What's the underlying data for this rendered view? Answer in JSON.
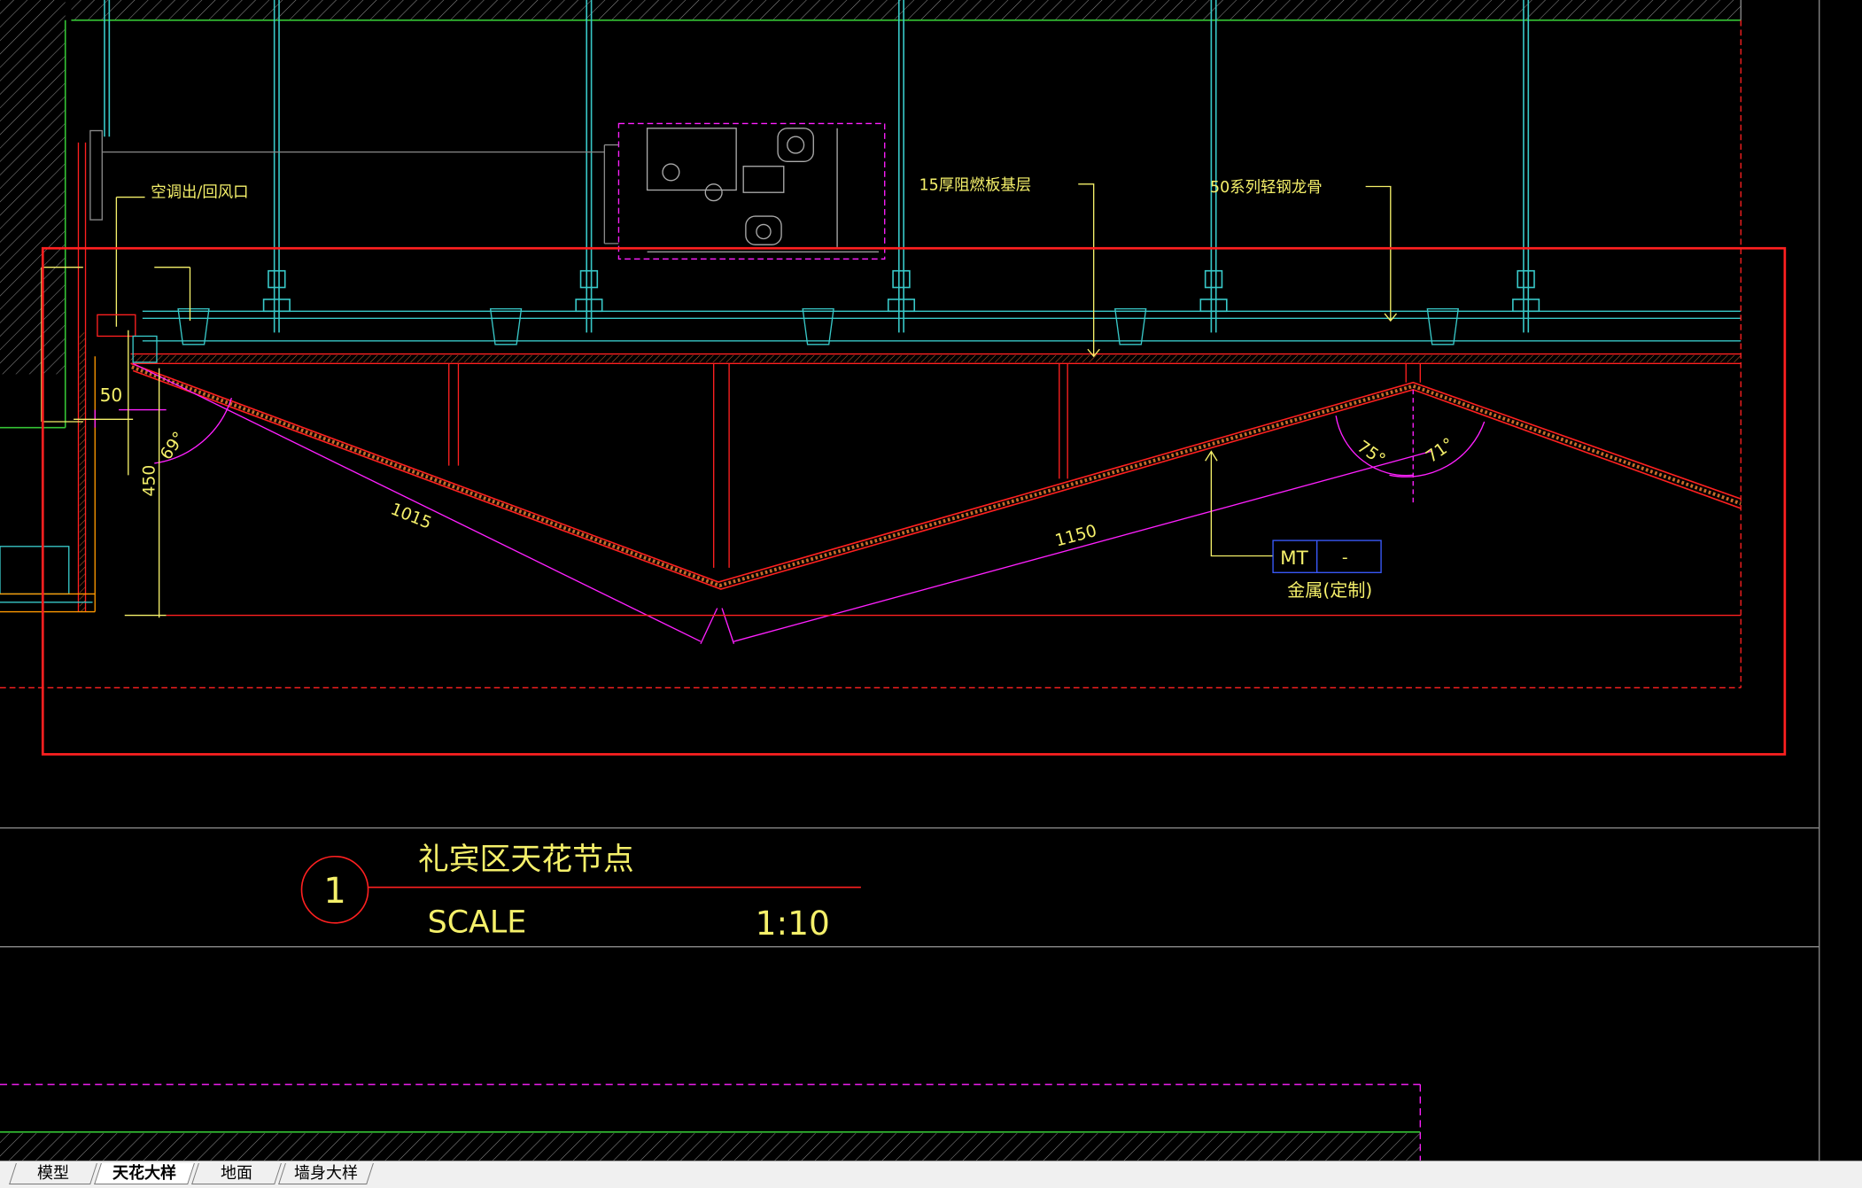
{
  "drawing": {
    "labels": {
      "ac_outlet": "空调出/回风口",
      "fireproof_board": "15厚阻燃板基层",
      "steel_keel": "50系列轻钢龙骨",
      "material_code": "MT",
      "material_dash": "-",
      "material_name": "金属(定制)"
    },
    "dimensions": {
      "d50": "50",
      "d450": "450",
      "d1015": "1015",
      "d1150": "1150",
      "a69": "69°",
      "a75": "75°",
      "a71": "71°"
    },
    "title_block": {
      "number": "1",
      "title": "礼宾区天花节点",
      "scale_label": "SCALE",
      "scale_value": "1:10"
    },
    "colors": {
      "background": "#000000",
      "red": "#ff2020",
      "yellow": "#f5f06a",
      "magenta": "#ff20ff",
      "cyan": "#38c8c8",
      "green": "#35c435",
      "gray": "#8a8a8a"
    }
  },
  "tabs": [
    {
      "label": "模型",
      "active": false
    },
    {
      "label": "天花大样",
      "active": true
    },
    {
      "label": "地面",
      "active": false
    },
    {
      "label": "墙身大样",
      "active": false
    }
  ]
}
